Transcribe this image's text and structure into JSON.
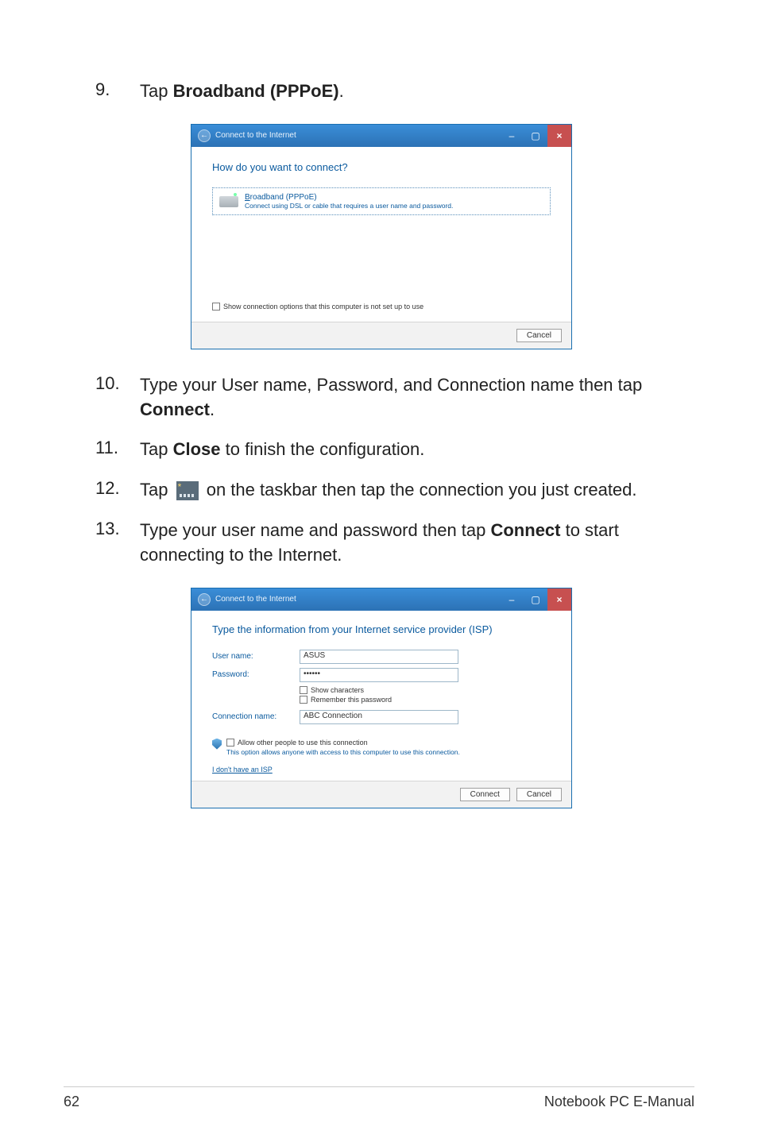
{
  "steps": {
    "s9": {
      "num": "9.",
      "pre": "Tap ",
      "bold": "Broadband (PPPoE)",
      "post": "."
    },
    "s10": {
      "num": "10.",
      "pre": "Type your User name, Password, and Connection name then tap ",
      "bold": "Connect",
      "post": "."
    },
    "s11": {
      "num": "11.",
      "pre": "Tap ",
      "bold": "Close",
      "post": " to finish the configuration."
    },
    "s12": {
      "num": "12.",
      "pre": "Tap ",
      "post_icon": " on the taskbar then tap the connection you just created."
    },
    "s13": {
      "num": "13.",
      "pre": "Type your user name and password then tap ",
      "bold": "Connect",
      "post": " to start connecting to the Internet."
    }
  },
  "dialog1": {
    "title": "Connect to the Internet",
    "heading": "How do you want to connect?",
    "option_title": "Broadband (PPPoE)",
    "option_sub": "Connect using DSL or cable that requires a user name and password.",
    "show_opts": "Show connection options that this computer is not set up to use",
    "cancel": "Cancel"
  },
  "dialog2": {
    "title": "Connect to the Internet",
    "heading": "Type the information from your Internet service provider (ISP)",
    "user_label": "User name:",
    "user_value": "ASUS",
    "pass_label": "Password:",
    "pass_value": "••••••",
    "show_chars": "Show characters",
    "remember": "Remember this password",
    "conn_label": "Connection name:",
    "conn_value": "ABC Connection",
    "allow_others": "Allow other people to use this connection",
    "allow_sub": "This option allows anyone with access to this computer to use this connection.",
    "no_isp": "I don't have an ISP",
    "connect": "Connect",
    "cancel": "Cancel"
  },
  "footer": {
    "page": "62",
    "title": "Notebook PC E-Manual"
  }
}
